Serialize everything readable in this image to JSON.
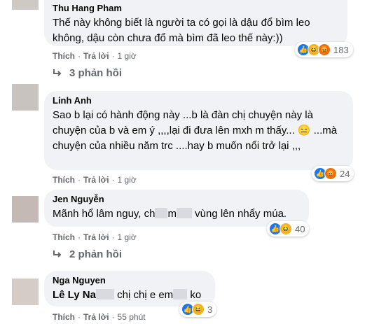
{
  "comments": [
    {
      "author": "Thu Hang Pham",
      "text": "Thế này không biết là người ta có gọi là dậu đổ bìm leo không, dậu còn chưa đổ mà bìm đã leo thế này:))",
      "reaction_count": "183",
      "like_label": "Thích",
      "reply_label": "Trả lời",
      "time": "1 giờ",
      "replies_label": "3 phản hồi"
    },
    {
      "author": "Linh Anh",
      "text": "Sao b lại có hành động này ...b là đàn chị chuyện này là chuyện của b và em ý ,,,,lại đi đưa lên mxh m thấy... 😑 ...mà chuyện của nhiều năm trc ....hay b muốn nổi trở lại ,,,",
      "reaction_count": "24",
      "like_label": "Thích",
      "reply_label": "Trả lời",
      "time": "1 giờ"
    },
    {
      "author": "Jen Nguyễn",
      "text_a": "Mãnh hổ lâm nguy, ch",
      "text_b": "m",
      "text_c": " vùng lên nhẩy múa.",
      "reaction_count": "40",
      "like_label": "Thích",
      "reply_label": "Trả lời",
      "time": "1 giờ",
      "replies_label": "2 phản hồi"
    },
    {
      "author": "Nga Nguyen",
      "tag": "Lê Ly Na",
      "text_a": " chị chị e em",
      "text_b": " ko",
      "reaction_count": "3",
      "like_label": "Thích",
      "reply_label": "Trả lời",
      "time": "55 phút"
    }
  ],
  "colors": {
    "bubble": "#f0f2f5",
    "meta": "#65676b",
    "like": "#1877f2",
    "haha": "#f7b125",
    "angry": "#e9710f"
  }
}
